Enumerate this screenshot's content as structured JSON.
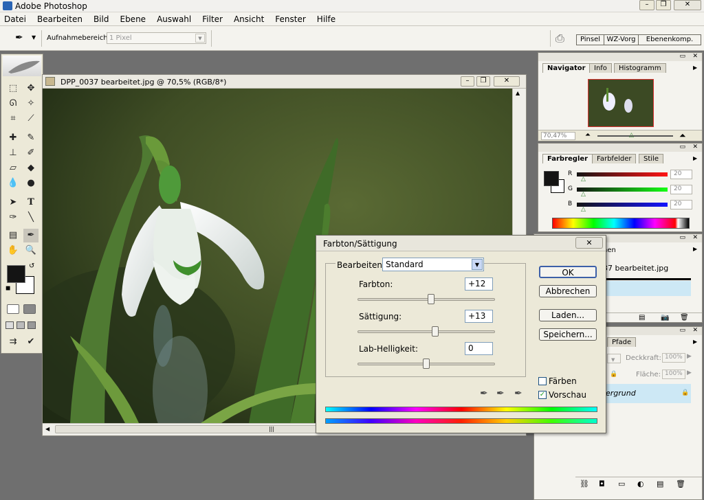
{
  "app": {
    "title": "Adobe Photoshop"
  },
  "menu": [
    "Datei",
    "Bearbeiten",
    "Bild",
    "Ebene",
    "Auswahl",
    "Filter",
    "Ansicht",
    "Fenster",
    "Hilfe"
  ],
  "options": {
    "sample_label": "Aufnahmebereich:",
    "sample_value": "1 Pixel",
    "dock_tabs": [
      "Pinsel",
      "WZ-Vorg",
      "Ebenenkomp."
    ]
  },
  "document": {
    "title": "DPP_0037 bearbeitet.jpg @ 70,5% (RGB/8*)"
  },
  "navigator": {
    "tabs": [
      "Navigator",
      "Info",
      "Histogramm"
    ],
    "zoom": "70,47%"
  },
  "color": {
    "tabs": [
      "Farbregler",
      "Farbfelder",
      "Stile"
    ],
    "channels": [
      {
        "name": "R",
        "value": "20"
      },
      {
        "name": "G",
        "value": "20"
      },
      {
        "name": "B",
        "value": "20"
      }
    ],
    "fg": "#141414",
    "bg": "#ffffff"
  },
  "history": {
    "tab_fragment": "nen",
    "file_fragment": "37 bearbeitet.jpg"
  },
  "layers": {
    "tab": "Pfade",
    "opacity_label": "Deckkraft:",
    "opacity": "100%",
    "fill_label": "Fläche:",
    "fill": "100%",
    "layer_name": "ergrund"
  },
  "dialog": {
    "title": "Farbton/Sättigung",
    "edit_label": "Bearbeiten:",
    "edit_value": "Standard",
    "hue_label": "Farbton:",
    "hue": "+12",
    "hue_level": 0.533,
    "sat_label": "Sättigung:",
    "sat": "+13",
    "sat_level": 0.565,
    "light_label": "Lab-Helligkeit:",
    "light": "0",
    "light_level": 0.5,
    "ok": "OK",
    "cancel": "Abbrechen",
    "load": "Laden...",
    "save": "Speichern...",
    "colorize": "Färben",
    "preview": "Vorschau"
  }
}
